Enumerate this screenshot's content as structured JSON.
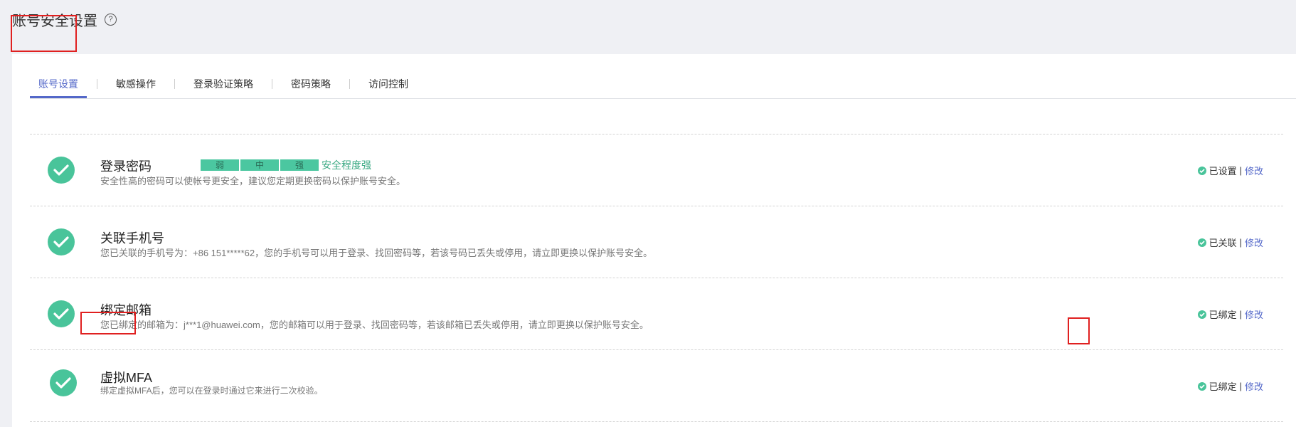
{
  "header": {
    "title": "账号安全设置",
    "help_icon": "help-circle-icon"
  },
  "tabs": [
    {
      "label": "账号设置",
      "active": true
    },
    {
      "label": "敏感操作"
    },
    {
      "label": "登录验证策略"
    },
    {
      "label": "密码策略"
    },
    {
      "label": "访问控制"
    }
  ],
  "colors": {
    "accent": "#5468c9",
    "success": "#49c49a",
    "highlight": "#e02020"
  },
  "items": [
    {
      "title": "登录密码",
      "description": "安全性高的密码可以使帐号更安全，建议您定期更换密码以保护账号安全。",
      "strength": {
        "levels": [
          "弱",
          "中",
          "强"
        ],
        "label": "安全程度强"
      },
      "status": "已设置",
      "separator": "|",
      "action": "修改"
    },
    {
      "title": "关联手机号",
      "description": "您已关联的手机号为：+86 151*****62，您的手机号可以用于登录、找回密码等，若该号码已丢失或停用，请立即更换以保护账号安全。",
      "status": "已关联",
      "separator": "|",
      "action": "修改"
    },
    {
      "title": "绑定邮箱",
      "description": "您已绑定的邮箱为：j***1@huawei.com，您的邮箱可以用于登录、找回密码等，若该邮箱已丢失或停用，请立即更换以保护账号安全。",
      "status": "已绑定",
      "separator": "|",
      "action": "修改"
    },
    {
      "title": "虚拟MFA",
      "description": "绑定虚拟MFA后，您可以在登录时通过它来进行二次校验。",
      "status": "已绑定",
      "separator": "|",
      "action": "修改"
    }
  ]
}
